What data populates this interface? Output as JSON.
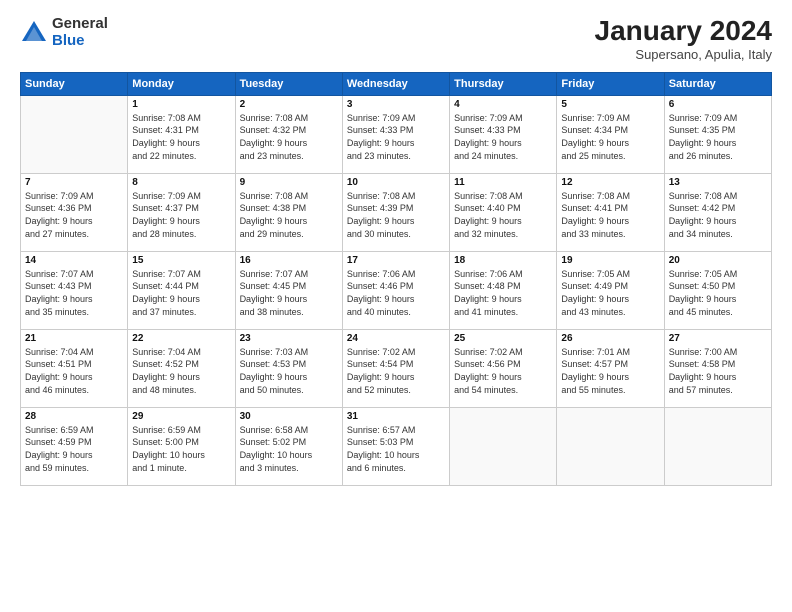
{
  "header": {
    "logo_general": "General",
    "logo_blue": "Blue",
    "title": "January 2024",
    "subtitle": "Supersano, Apulia, Italy"
  },
  "days_of_week": [
    "Sunday",
    "Monday",
    "Tuesday",
    "Wednesday",
    "Thursday",
    "Friday",
    "Saturday"
  ],
  "weeks": [
    [
      {
        "num": "",
        "info": ""
      },
      {
        "num": "1",
        "info": "Sunrise: 7:08 AM\nSunset: 4:31 PM\nDaylight: 9 hours\nand 22 minutes."
      },
      {
        "num": "2",
        "info": "Sunrise: 7:08 AM\nSunset: 4:32 PM\nDaylight: 9 hours\nand 23 minutes."
      },
      {
        "num": "3",
        "info": "Sunrise: 7:09 AM\nSunset: 4:33 PM\nDaylight: 9 hours\nand 23 minutes."
      },
      {
        "num": "4",
        "info": "Sunrise: 7:09 AM\nSunset: 4:33 PM\nDaylight: 9 hours\nand 24 minutes."
      },
      {
        "num": "5",
        "info": "Sunrise: 7:09 AM\nSunset: 4:34 PM\nDaylight: 9 hours\nand 25 minutes."
      },
      {
        "num": "6",
        "info": "Sunrise: 7:09 AM\nSunset: 4:35 PM\nDaylight: 9 hours\nand 26 minutes."
      }
    ],
    [
      {
        "num": "7",
        "info": "Sunrise: 7:09 AM\nSunset: 4:36 PM\nDaylight: 9 hours\nand 27 minutes."
      },
      {
        "num": "8",
        "info": "Sunrise: 7:09 AM\nSunset: 4:37 PM\nDaylight: 9 hours\nand 28 minutes."
      },
      {
        "num": "9",
        "info": "Sunrise: 7:08 AM\nSunset: 4:38 PM\nDaylight: 9 hours\nand 29 minutes."
      },
      {
        "num": "10",
        "info": "Sunrise: 7:08 AM\nSunset: 4:39 PM\nDaylight: 9 hours\nand 30 minutes."
      },
      {
        "num": "11",
        "info": "Sunrise: 7:08 AM\nSunset: 4:40 PM\nDaylight: 9 hours\nand 32 minutes."
      },
      {
        "num": "12",
        "info": "Sunrise: 7:08 AM\nSunset: 4:41 PM\nDaylight: 9 hours\nand 33 minutes."
      },
      {
        "num": "13",
        "info": "Sunrise: 7:08 AM\nSunset: 4:42 PM\nDaylight: 9 hours\nand 34 minutes."
      }
    ],
    [
      {
        "num": "14",
        "info": "Sunrise: 7:07 AM\nSunset: 4:43 PM\nDaylight: 9 hours\nand 35 minutes."
      },
      {
        "num": "15",
        "info": "Sunrise: 7:07 AM\nSunset: 4:44 PM\nDaylight: 9 hours\nand 37 minutes."
      },
      {
        "num": "16",
        "info": "Sunrise: 7:07 AM\nSunset: 4:45 PM\nDaylight: 9 hours\nand 38 minutes."
      },
      {
        "num": "17",
        "info": "Sunrise: 7:06 AM\nSunset: 4:46 PM\nDaylight: 9 hours\nand 40 minutes."
      },
      {
        "num": "18",
        "info": "Sunrise: 7:06 AM\nSunset: 4:48 PM\nDaylight: 9 hours\nand 41 minutes."
      },
      {
        "num": "19",
        "info": "Sunrise: 7:05 AM\nSunset: 4:49 PM\nDaylight: 9 hours\nand 43 minutes."
      },
      {
        "num": "20",
        "info": "Sunrise: 7:05 AM\nSunset: 4:50 PM\nDaylight: 9 hours\nand 45 minutes."
      }
    ],
    [
      {
        "num": "21",
        "info": "Sunrise: 7:04 AM\nSunset: 4:51 PM\nDaylight: 9 hours\nand 46 minutes."
      },
      {
        "num": "22",
        "info": "Sunrise: 7:04 AM\nSunset: 4:52 PM\nDaylight: 9 hours\nand 48 minutes."
      },
      {
        "num": "23",
        "info": "Sunrise: 7:03 AM\nSunset: 4:53 PM\nDaylight: 9 hours\nand 50 minutes."
      },
      {
        "num": "24",
        "info": "Sunrise: 7:02 AM\nSunset: 4:54 PM\nDaylight: 9 hours\nand 52 minutes."
      },
      {
        "num": "25",
        "info": "Sunrise: 7:02 AM\nSunset: 4:56 PM\nDaylight: 9 hours\nand 54 minutes."
      },
      {
        "num": "26",
        "info": "Sunrise: 7:01 AM\nSunset: 4:57 PM\nDaylight: 9 hours\nand 55 minutes."
      },
      {
        "num": "27",
        "info": "Sunrise: 7:00 AM\nSunset: 4:58 PM\nDaylight: 9 hours\nand 57 minutes."
      }
    ],
    [
      {
        "num": "28",
        "info": "Sunrise: 6:59 AM\nSunset: 4:59 PM\nDaylight: 9 hours\nand 59 minutes."
      },
      {
        "num": "29",
        "info": "Sunrise: 6:59 AM\nSunset: 5:00 PM\nDaylight: 10 hours\nand 1 minute."
      },
      {
        "num": "30",
        "info": "Sunrise: 6:58 AM\nSunset: 5:02 PM\nDaylight: 10 hours\nand 3 minutes."
      },
      {
        "num": "31",
        "info": "Sunrise: 6:57 AM\nSunset: 5:03 PM\nDaylight: 10 hours\nand 6 minutes."
      },
      {
        "num": "",
        "info": ""
      },
      {
        "num": "",
        "info": ""
      },
      {
        "num": "",
        "info": ""
      }
    ]
  ]
}
